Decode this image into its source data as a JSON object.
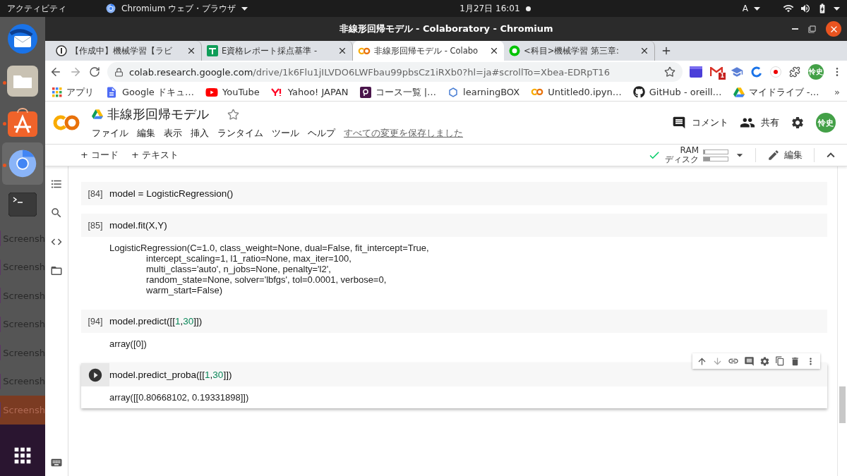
{
  "top_bar": {
    "activities": "アクティビティ",
    "app_menu": "Chromium ウェブ・ブラウザ",
    "clock": "1月27日 16:01",
    "input_method": "A"
  },
  "dock": {
    "labels": [
      {
        "text": "Screensh",
        "selected": false
      },
      {
        "text": "Screensh",
        "selected": false
      },
      {
        "text": "Screensh",
        "selected": false
      },
      {
        "text": "Screensh",
        "selected": false
      },
      {
        "text": "Screensh",
        "selected": false
      },
      {
        "text": "Screensh",
        "selected": false
      },
      {
        "text": "Screensh",
        "selected": true
      }
    ]
  },
  "window": {
    "title": "非線形回帰モデル - Colaboratory - Chromium"
  },
  "tabs": [
    {
      "label": "【作成中】機械学習【ラビ",
      "selected": false
    },
    {
      "label": "E資格レポート採点基準 -",
      "selected": false
    },
    {
      "label": "非線形回帰モデル - Colabo",
      "selected": true
    },
    {
      "label": "<科目>機械学習 第三章:",
      "selected": false
    }
  ],
  "address_bar": {
    "host": "colab.research.google.com",
    "path": "/drive/1k6Flu1jILVDO6LWFbau99pbsCz1iRXb0?hl=ja#scrollTo=Xbea-EDRpT16"
  },
  "extensions": {
    "mail_badge": "1",
    "avatar": "怜史"
  },
  "bookmarks": [
    {
      "label": "アプリ"
    },
    {
      "label": "Google ドキュ…"
    },
    {
      "label": "YouTube"
    },
    {
      "label": "Yahoo! JAPAN"
    },
    {
      "label": "コース一覧 |…"
    },
    {
      "label": "learningBOX"
    },
    {
      "label": "Untitled0.ipyn…"
    },
    {
      "label": "GitHub - oreill…"
    },
    {
      "label": "マイドライブ -…"
    }
  ],
  "bookmarks_more": "»",
  "notebook": {
    "title": "非線形回帰モデル",
    "menu": [
      "ファイル",
      "編集",
      "表示",
      "挿入",
      "ランタイム",
      "ツール",
      "ヘルプ"
    ],
    "save_status": "すべての変更を保存しました",
    "comment": "コメント",
    "share": "共有",
    "avatar": "怜史"
  },
  "toolbar": {
    "add_code": "+ コード",
    "add_text": "+ テキスト",
    "ram": {
      "label": "RAM",
      "level": 0.05
    },
    "disk": {
      "label": "ディスク",
      "level": 0.25
    },
    "edit": "編集"
  },
  "cells": [
    {
      "kind": "executed",
      "count": "[84]",
      "code": [
        {
          "kind": "plain",
          "text": "model = LogisticRegression()"
        }
      ]
    },
    {
      "kind": "executed",
      "count": "[85]",
      "code": [
        {
          "kind": "plain",
          "text": "model.fit(X,Y)"
        }
      ],
      "output": [
        "LogisticRegression(C=1.0, class_weight=None, dual=False, fit_intercept=True,",
        "intercept_scaling=1, l1_ratio=None, max_iter=100,",
        "multi_class='auto', n_jobs=None, penalty='l2',",
        "random_state=None, solver='lbfgs', tol=0.0001, verbose=0,",
        "warm_start=False)"
      ]
    },
    {
      "kind": "executed",
      "count": "[94]",
      "code": [
        {
          "kind": "plain",
          "text": "model.predict([["
        },
        {
          "kind": "number",
          "text": "1"
        },
        {
          "kind": "plain",
          "text": ","
        },
        {
          "kind": "number",
          "text": "30"
        },
        {
          "kind": "plain",
          "text": "]])"
        }
      ],
      "output": [
        "array([0])"
      ]
    },
    {
      "kind": "active",
      "code": [
        {
          "kind": "plain",
          "text": "model.predict_proba([["
        },
        {
          "kind": "number",
          "text": "1"
        },
        {
          "kind": "plain",
          "text": ","
        },
        {
          "kind": "number",
          "text": "30"
        },
        {
          "kind": "plain",
          "text": "]])"
        }
      ],
      "output": [
        "array([[0.80668102, 0.19331898]])"
      ]
    }
  ]
}
